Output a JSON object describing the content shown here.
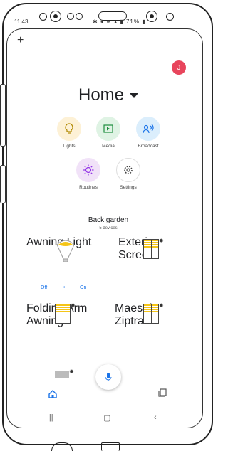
{
  "status_bar": {
    "time": "11:43",
    "battery": "71%"
  },
  "header": {
    "title": "Home",
    "avatar_initial": "J"
  },
  "actions": [
    {
      "label": "Lights",
      "icon": "lightbulb-icon",
      "color": "#fdf1d6"
    },
    {
      "label": "Media",
      "icon": "media-icon",
      "color": "#dff3e4"
    },
    {
      "label": "Broadcast",
      "icon": "broadcast-icon",
      "color": "#dbeefc"
    },
    {
      "label": "Routines",
      "icon": "routines-icon",
      "color": "#f1e2f8"
    },
    {
      "label": "Settings",
      "icon": "gear-icon",
      "color": "#ffffff"
    }
  ],
  "room": {
    "title": "Back garden",
    "subtitle": "5 devices"
  },
  "devices": [
    {
      "name": "Awning Light",
      "off_label": "Off",
      "dot": "•",
      "on_label": "On"
    },
    {
      "name": "Exterior Screen"
    },
    {
      "name": "Folding Arm Awning"
    },
    {
      "name": "Maestria Ziptrack"
    }
  ],
  "colors": {
    "accent": "#1a73e8",
    "avatar": "#e8455c",
    "blind": "#f5c518"
  }
}
